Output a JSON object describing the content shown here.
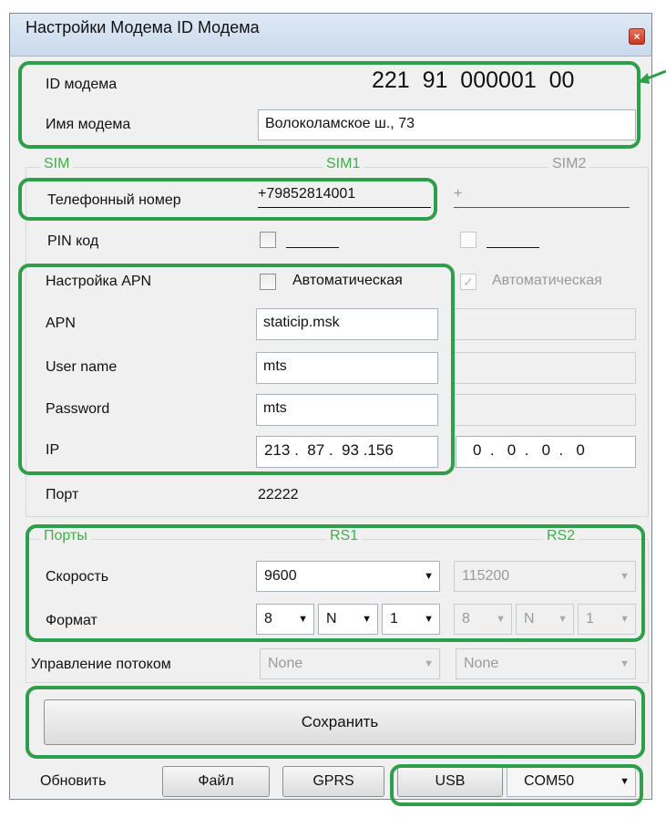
{
  "window": {
    "title": "Настройки Модема ID Модема",
    "close_glyph": "×"
  },
  "modem": {
    "id_label": "ID модема",
    "id_value": "221  91  000001  00",
    "name_label": "Имя модема",
    "name_value": "Волоколамское ш., 73"
  },
  "sim": {
    "group_label": "SIM",
    "sim1_label": "SIM1",
    "sim2_label": "SIM2",
    "phone_label": "Телефонный номер",
    "phone1": "+79852814001",
    "phone2": "+",
    "pin_label": "PIN код",
    "apn_setting_label": "Настройка APN",
    "auto_label1": "Автоматическая",
    "auto_label2": "Автоматическая",
    "auto2_check": "✓",
    "apn_label": "APN",
    "apn1": "staticip.msk",
    "user_label": "User name",
    "user1": "mts",
    "password_label": "Password",
    "password1": "mts",
    "ip_label": "IP",
    "ip1": "213 .  87 .  93 .156",
    "ip2": "0  .   0  .   0  .   0",
    "port_label": "Порт",
    "port_value": "22222"
  },
  "ports": {
    "group_label": "Порты",
    "rs1_label": "RS1",
    "rs2_label": "RS2",
    "speed_label": "Скорость",
    "speed1": "9600",
    "speed2": "115200",
    "format_label": "Формат",
    "bits1": "8",
    "parity1": "N",
    "stop1": "1",
    "bits2": "8",
    "parity2": "N",
    "stop2": "1",
    "flow_label": "Управление потоком",
    "flow1": "None",
    "flow2": "None",
    "dropdown_glyph": "▼"
  },
  "actions": {
    "save_label": "Сохранить",
    "refresh_label": "Обновить",
    "file_label": "Файл",
    "gprs_label": "GPRS",
    "usb_label": "USB",
    "com_value": "COM50"
  }
}
